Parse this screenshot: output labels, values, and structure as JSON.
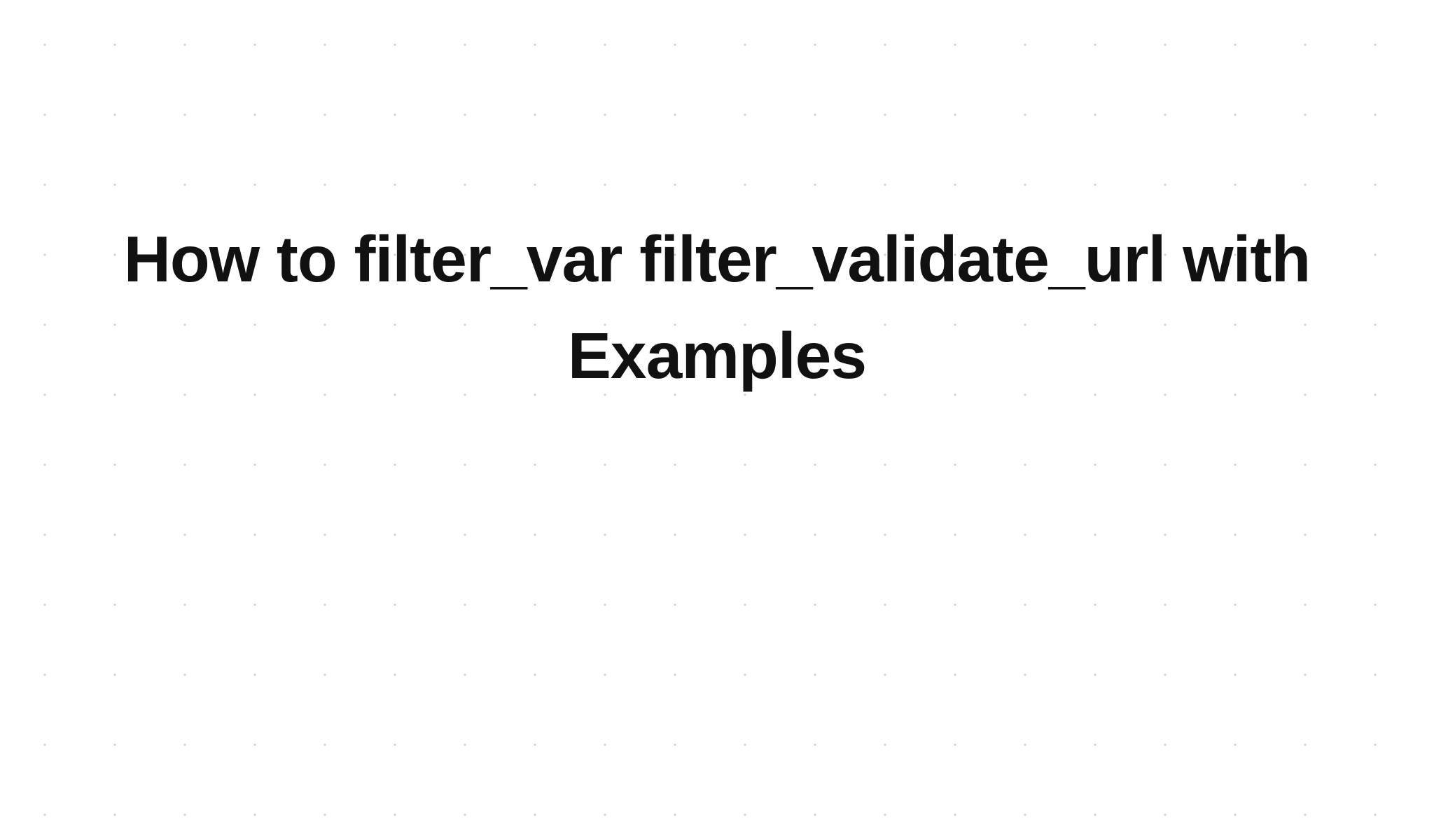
{
  "document": {
    "title": "How to filter_var filter_validate_url with Examples"
  },
  "style": {
    "background_color": "#ffffff",
    "dot_color": "#d0d0d0",
    "text_color": "#111111"
  }
}
